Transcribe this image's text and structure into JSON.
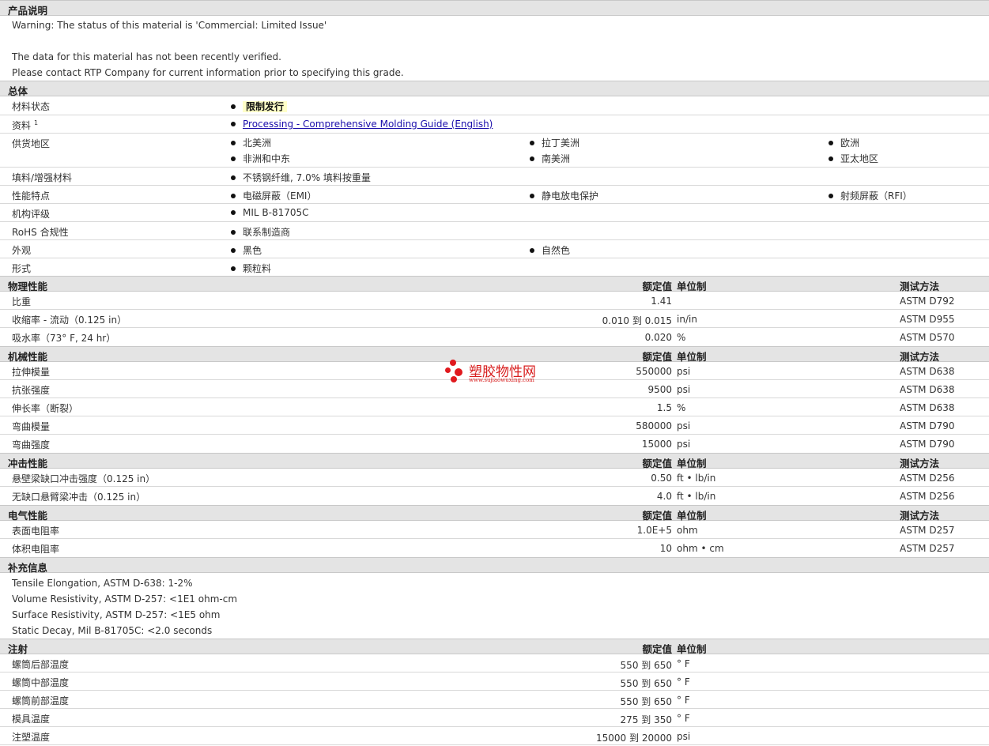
{
  "desc": {
    "title": "产品说明",
    "lines": [
      "Warning: The status of this material is 'Commercial: Limited Issue'",
      "The data for this material has not been recently verified.",
      "Please contact RTP Company for current information prior to specifying this grade."
    ]
  },
  "general": {
    "title": "总体",
    "rows": [
      {
        "label": "材料状态",
        "values": [
          "限制发行"
        ]
      },
      {
        "label": "资料",
        "sup": "1",
        "values": [
          "Processing - Comprehensive Molding Guide (English)"
        ]
      },
      {
        "label": "供货地区",
        "values": [
          "北美洲",
          "拉丁美洲",
          "欧洲",
          "非洲和中东",
          "南美洲",
          "亚太地区"
        ]
      },
      {
        "label": "填料/增强材料",
        "values": [
          "不锈钢纤维, 7.0% 填料按重量"
        ]
      },
      {
        "label": "性能特点",
        "values": [
          "电磁屏蔽（EMI）",
          "静电放电保护",
          "射频屏蔽（RFI）"
        ]
      },
      {
        "label": "机构评级",
        "values": [
          "MIL B-81705C"
        ]
      },
      {
        "label": "RoHS 合规性",
        "values": [
          "联系制造商"
        ]
      },
      {
        "label": "外观",
        "values": [
          "黑色",
          "自然色"
        ]
      },
      {
        "label": "形式",
        "values": [
          "颗粒料"
        ]
      }
    ]
  },
  "headers": {
    "nominal": "额定值",
    "unit": "单位制",
    "method": "测试方法"
  },
  "physical": {
    "title": "物理性能",
    "rows": [
      {
        "label": "比重",
        "value": "1.41",
        "unit": "",
        "method": "ASTM D792"
      },
      {
        "label": "收缩率 - 流动（0.125 in）",
        "value": "0.010 到 0.015",
        "unit": "in/in",
        "method": "ASTM D955"
      },
      {
        "label": "吸水率（73° F, 24 hr）",
        "value": "0.020",
        "unit": "%",
        "method": "ASTM D570"
      }
    ]
  },
  "mechanical": {
    "title": "机械性能",
    "rows": [
      {
        "label": "拉伸模量",
        "value": "550000",
        "unit": "psi",
        "method": "ASTM D638"
      },
      {
        "label": "抗张强度",
        "value": "9500",
        "unit": "psi",
        "method": "ASTM D638"
      },
      {
        "label": "伸长率（断裂）",
        "value": "1.5",
        "unit": "%",
        "method": "ASTM D638"
      },
      {
        "label": "弯曲模量",
        "value": "580000",
        "unit": "psi",
        "method": "ASTM D790"
      },
      {
        "label": "弯曲强度",
        "value": "15000",
        "unit": "psi",
        "method": "ASTM D790"
      }
    ]
  },
  "impact": {
    "title": "冲击性能",
    "rows": [
      {
        "label": "悬壁梁缺口冲击强度（0.125 in）",
        "value": "0.50",
        "unit": "ft • lb/in",
        "method": "ASTM D256"
      },
      {
        "label": "无缺口悬臂梁冲击（0.125 in）",
        "value": "4.0",
        "unit": "ft • lb/in",
        "method": "ASTM D256"
      }
    ]
  },
  "electrical": {
    "title": "电气性能",
    "rows": [
      {
        "label": "表面电阻率",
        "value": "1.0E+5",
        "unit": "ohm",
        "method": "ASTM D257"
      },
      {
        "label": "体积电阻率",
        "value": "10",
        "unit": "ohm • cm",
        "method": "ASTM D257"
      }
    ]
  },
  "supplement": {
    "title": "补充信息",
    "lines": [
      "Tensile Elongation, ASTM D-638: 1-2%",
      "Volume Resistivity, ASTM D-257: <1E1 ohm-cm",
      "Surface Resistivity, ASTM D-257: <1E5 ohm",
      "Static Decay, Mil B-81705C: <2.0 seconds"
    ]
  },
  "injection": {
    "title": "注射",
    "rows": [
      {
        "label": "螺筒后部温度",
        "value": "550 到 650",
        "unit": "° F"
      },
      {
        "label": "螺筒中部温度",
        "value": "550 到 650",
        "unit": "° F"
      },
      {
        "label": "螺筒前部温度",
        "value": "550 到 650",
        "unit": "° F"
      },
      {
        "label": "模具温度",
        "value": "275 到 350",
        "unit": "° F"
      },
      {
        "label": "注塑温度",
        "value": "15000 到 20000",
        "unit": "psi"
      }
    ]
  },
  "watermark": {
    "name": "塑胶物性网",
    "url": "www.sujiaowuxing.com"
  }
}
